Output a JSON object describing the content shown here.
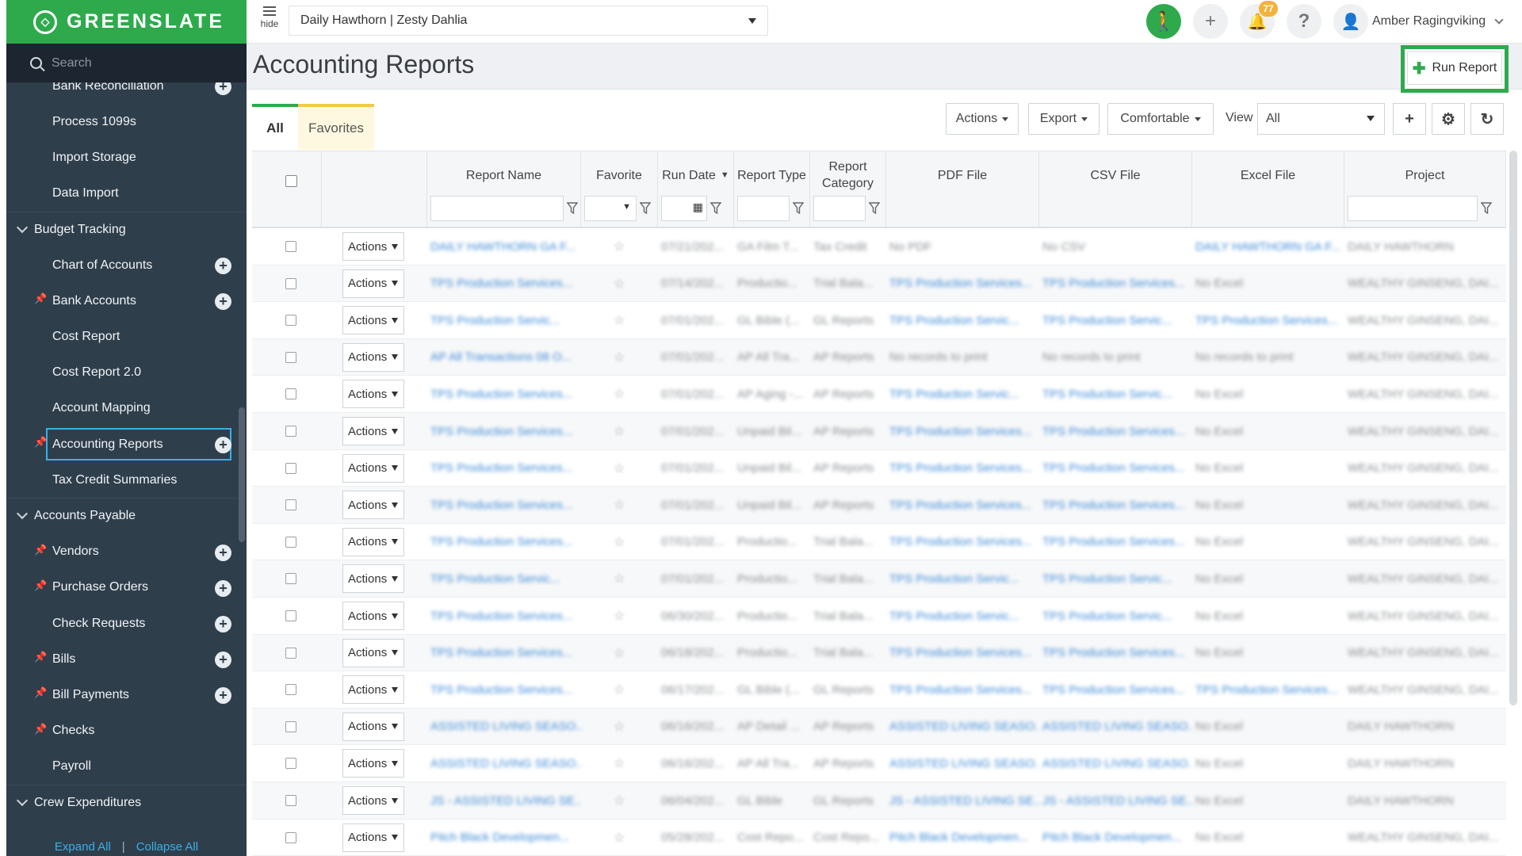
{
  "brand": {
    "name": "GREENSLATE"
  },
  "sidebar": {
    "search_placeholder": "Search",
    "items": [
      {
        "label": "Bank Reconciliation",
        "pinned": false,
        "add": true
      },
      {
        "label": "Process 1099s",
        "pinned": false,
        "add": false
      },
      {
        "label": "Import Storage",
        "pinned": false,
        "add": false
      },
      {
        "label": "Data Import",
        "pinned": false,
        "add": false
      }
    ],
    "group_budget": "Budget Tracking",
    "budget_items": [
      {
        "label": "Chart of Accounts",
        "pinned": false,
        "add": true
      },
      {
        "label": "Bank Accounts",
        "pinned": true,
        "add": true
      },
      {
        "label": "Cost Report",
        "pinned": false,
        "add": false
      },
      {
        "label": "Cost Report 2.0",
        "pinned": false,
        "add": false
      },
      {
        "label": "Account Mapping",
        "pinned": false,
        "add": false
      },
      {
        "label": "Accounting Reports",
        "pinned": true,
        "add": true,
        "active": true
      },
      {
        "label": "Tax Credit Summaries",
        "pinned": false,
        "add": false
      }
    ],
    "group_ap": "Accounts Payable",
    "ap_items": [
      {
        "label": "Vendors",
        "pinned": true,
        "add": true
      },
      {
        "label": "Purchase Orders",
        "pinned": true,
        "add": true
      },
      {
        "label": "Check Requests",
        "pinned": false,
        "add": true
      },
      {
        "label": "Bills",
        "pinned": true,
        "add": true
      },
      {
        "label": "Bill Payments",
        "pinned": true,
        "add": true
      },
      {
        "label": "Checks",
        "pinned": true,
        "add": false
      },
      {
        "label": "Payroll",
        "pinned": false,
        "add": false
      }
    ],
    "group_crew": "Crew Expenditures",
    "expand_all": "Expand All",
    "collapse_all": "Collapse All",
    "separator": "|"
  },
  "topbar": {
    "hide_label": "hide",
    "project": "Daily Hawthorn | Zesty Dahlia",
    "notification_count": "77",
    "user_name": "Amber Ragingviking"
  },
  "page": {
    "title": "Accounting Reports",
    "run_report": "Run Report"
  },
  "tabs": {
    "all": "All",
    "favorites": "Favorites"
  },
  "toolbar": {
    "actions": "Actions",
    "export": "Export",
    "density": "Comfortable",
    "view_label": "View",
    "view_value": "All"
  },
  "columns": {
    "report_name": "Report Name",
    "favorite": "Favorite",
    "run_date": "Run Date",
    "report_type": "Report Type",
    "report_category": "Report Category",
    "pdf_file": "PDF File",
    "csv_file": "CSV File",
    "excel_file": "Excel File",
    "project": "Project"
  },
  "row_action_label": "Actions",
  "rows": [
    {
      "name": "DAILY HAWTHORN GA F...",
      "date": "07/21/202...",
      "type": "GA Film T...",
      "category": "Tax Credit",
      "pdf": "No PDF",
      "csv": "No CSV",
      "excel": "DAILY HAWTHORN GA F...",
      "project": "DAILY HAWTHORN"
    },
    {
      "name": "TPS Production Services...",
      "date": "07/14/202...",
      "type": "Productio...",
      "category": "Trial Bala...",
      "pdf": "TPS Production Services...",
      "csv": "TPS Production Services...",
      "excel": "No Excel",
      "project": "WEALTHY GINSENG, DAI..."
    },
    {
      "name": "TPS Production Servic...",
      "date": "07/01/202...",
      "type": "GL Bible (...",
      "category": "GL Reports",
      "pdf": "TPS Production Servic...",
      "csv": "TPS Production Servic...",
      "excel": "TPS Production Services...",
      "project": "WEALTHY GINSENG, DAI..."
    },
    {
      "name": "AP All Transactions 08 O...",
      "date": "07/01/202...",
      "type": "AP All Tra...",
      "category": "AP Reports",
      "pdf": "No records to print",
      "csv": "No records to print",
      "excel": "No records to print",
      "project": "WEALTHY GINSENG, DAI..."
    },
    {
      "name": "TPS Production Services...",
      "date": "07/01/202...",
      "type": "AP Aging -...",
      "category": "AP Reports",
      "pdf": "TPS Production Servic...",
      "csv": "TPS Production Servic...",
      "excel": "No Excel",
      "project": "WEALTHY GINSENG, DAI..."
    },
    {
      "name": "TPS Production Services...",
      "date": "07/01/202...",
      "type": "Unpaid Bil...",
      "category": "AP Reports",
      "pdf": "TPS Production Services...",
      "csv": "TPS Production Services...",
      "excel": "No Excel",
      "project": "WEALTHY GINSENG, DAI..."
    },
    {
      "name": "TPS Production Services...",
      "date": "07/01/202...",
      "type": "Unpaid Bil...",
      "category": "AP Reports",
      "pdf": "TPS Production Services...",
      "csv": "TPS Production Services...",
      "excel": "No Excel",
      "project": "WEALTHY GINSENG, DAI..."
    },
    {
      "name": "TPS Production Services...",
      "date": "07/01/202...",
      "type": "Unpaid Bil...",
      "category": "AP Reports",
      "pdf": "TPS Production Services...",
      "csv": "TPS Production Services...",
      "excel": "No Excel",
      "project": "WEALTHY GINSENG, DAI..."
    },
    {
      "name": "TPS Production Services...",
      "date": "07/01/202...",
      "type": "Productio...",
      "category": "Trial Bala...",
      "pdf": "TPS Production Services...",
      "csv": "TPS Production Services...",
      "excel": "No Excel",
      "project": "WEALTHY GINSENG, DAI..."
    },
    {
      "name": "TPS Production Servic...",
      "date": "07/01/202...",
      "type": "Productio...",
      "category": "Trial Bala...",
      "pdf": "TPS Production Servic...",
      "csv": "TPS Production Servic...",
      "excel": "No Excel",
      "project": "WEALTHY GINSENG, DAI..."
    },
    {
      "name": "TPS Production Services...",
      "date": "06/30/202...",
      "type": "Productio...",
      "category": "Trial Bala...",
      "pdf": "TPS Production Servic...",
      "csv": "TPS Production Servic...",
      "excel": "No Excel",
      "project": "WEALTHY GINSENG, DAI..."
    },
    {
      "name": "TPS Production Services...",
      "date": "06/18/202...",
      "type": "Productio...",
      "category": "Trial Bala...",
      "pdf": "TPS Production Services...",
      "csv": "TPS Production Services...",
      "excel": "No Excel",
      "project": "WEALTHY GINSENG, DAI..."
    },
    {
      "name": "TPS Production Services...",
      "date": "06/17/202...",
      "type": "GL Bible (...",
      "category": "GL Reports",
      "pdf": "TPS Production Services...",
      "csv": "TPS Production Services...",
      "excel": "TPS Production Services...",
      "project": "WEALTHY GINSENG, DAI..."
    },
    {
      "name": "ASSISTED LIVING SEASO...",
      "date": "06/16/202...",
      "type": "AP Detail ...",
      "category": "AP Reports",
      "pdf": "ASSISTED LIVING SEASO...",
      "csv": "ASSISTED LIVING SEASO...",
      "excel": "No Excel",
      "project": "DAILY HAWTHORN"
    },
    {
      "name": "ASSISTED LIVING SEASO...",
      "date": "06/16/202...",
      "type": "AP All Tra...",
      "category": "AP Reports",
      "pdf": "ASSISTED LIVING SEASO...",
      "csv": "ASSISTED LIVING SEASO...",
      "excel": "No Excel",
      "project": "DAILY HAWTHORN"
    },
    {
      "name": "JS - ASSISTED LIVING SE...",
      "date": "06/04/202...",
      "type": "GL Bible",
      "category": "GL Reports",
      "pdf": "JS - ASSISTED LIVING SE...",
      "csv": "JS - ASSISTED LIVING SE...",
      "excel": "No Excel",
      "project": "DAILY HAWTHORN"
    },
    {
      "name": "Pitch Black Developmen...",
      "date": "05/28/202...",
      "type": "Cost Repo...",
      "category": "Cost Repo...",
      "pdf": "Pitch Black Developmen...",
      "csv": "Pitch Black Developmen...",
      "excel": "No Excel",
      "project": "WEALTHY GINSENG, DAI..."
    }
  ],
  "colors": {
    "brand_green": "#2eaa4d",
    "sidebar_bg": "#2f3e4b",
    "link_blue": "#3c8ad8",
    "active_outline": "#3ab0e6",
    "badge": "#f3b23a"
  }
}
